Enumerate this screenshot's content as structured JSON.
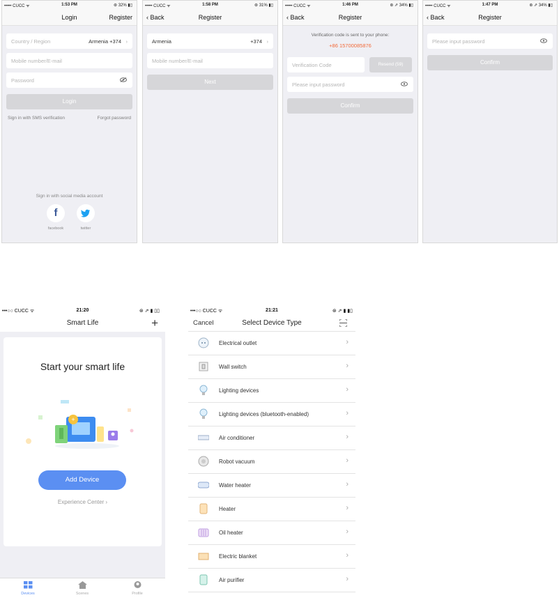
{
  "status": {
    "carrier": "••••• CUCC ᯤ",
    "carrier2": "•••○○ CUCC ᯤ",
    "times": [
      "1:53 PM",
      "1:58 PM",
      "1:46 PM",
      "1:47 PM",
      "21:20",
      "21:21"
    ],
    "battery": [
      "⊛ 32% ▮▯",
      "⊛ 31% ▮▯",
      "⊛ ⇗ 34% ▮▯",
      "⊛ ⇗ 34% ▮▯"
    ]
  },
  "login": {
    "title": "Login",
    "register": "Register",
    "country_label": "Country / Region",
    "country_value": "Armenia +374",
    "mobile_placeholder": "Mobile number/E-mail",
    "password_placeholder": "Password",
    "login_button": "Login",
    "sms_link": "Sign in with SMS verification",
    "forgot_link": "Forgot password",
    "social_label": "Sign in with social media account",
    "facebook": "facebook",
    "twitter": "twitter"
  },
  "register1": {
    "back": "Back",
    "title": "Register",
    "country": "Armenia",
    "code": "+374",
    "mobile_placeholder": "Mobile number/E-mail",
    "next_button": "Next"
  },
  "register2": {
    "back": "Back",
    "title": "Register",
    "notice": "Verification code is sent to your phone:",
    "phone": "+86 15700085876",
    "code_placeholder": "Verification Code",
    "resend": "Resend (59)",
    "password_placeholder": "Please input password",
    "confirm_button": "Confirm"
  },
  "register3": {
    "back": "Back",
    "title": "Register",
    "password_placeholder": "Please input password",
    "confirm_button": "Confirm"
  },
  "smart": {
    "title": "Smart Life",
    "plus": "+",
    "headline": "Start your smart life",
    "add_button": "Add Device",
    "experience": "Experience Center ›",
    "tabs": [
      "Devices",
      "Scenes",
      "Profile"
    ]
  },
  "select": {
    "cancel": "Cancel",
    "title": "Select Device Type",
    "items": [
      "Electrical outlet",
      "Wall switch",
      "Lighting devices",
      "Lighting devices (bluetooth-enabled)",
      "Air conditioner",
      "Robot vacuum",
      "Water heater",
      "Heater",
      "Oil heater",
      "Electric blanket",
      "Air purifier"
    ]
  },
  "colors": {
    "accent": "#5b8ff2",
    "phone_link": "#f26b3a",
    "disabled_button": "#d6d6d9",
    "background": "#efeff4"
  }
}
